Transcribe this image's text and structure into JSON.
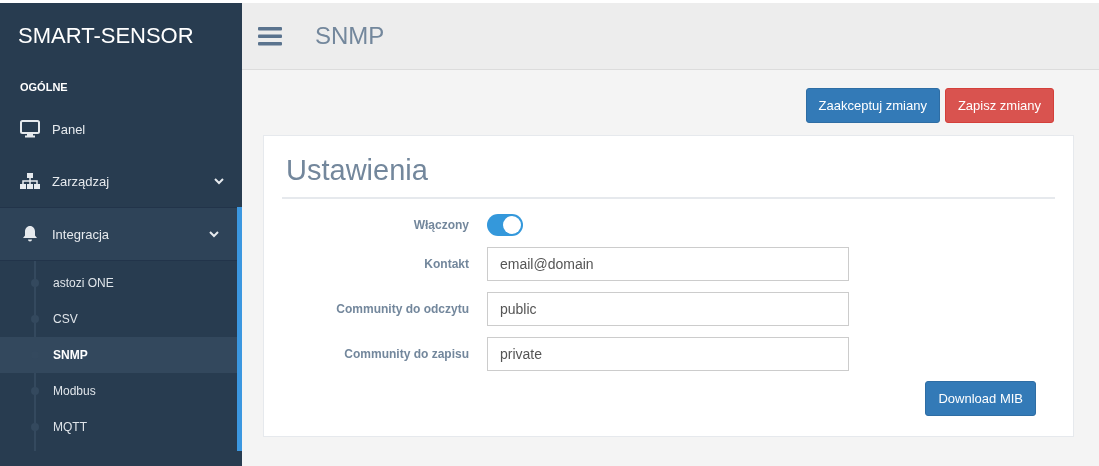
{
  "sidebar": {
    "brand": "SMART-SENSOR",
    "section_label": "OGÓLNE",
    "items": [
      {
        "kind": "link",
        "label": "Panel"
      },
      {
        "kind": "group",
        "label": "Zarządzaj",
        "expanded": false
      },
      {
        "kind": "group",
        "label": "Integracja",
        "expanded": true,
        "children": [
          {
            "label": "astozi ONE",
            "selected": false
          },
          {
            "label": "CSV",
            "selected": false
          },
          {
            "label": "SNMP",
            "selected": true
          },
          {
            "label": "Modbus",
            "selected": false
          },
          {
            "label": "MQTT",
            "selected": false
          }
        ]
      }
    ]
  },
  "header": {
    "title": "SNMP"
  },
  "actions": [
    {
      "kind": "primary",
      "label": "Zaakceptuj zmiany"
    },
    {
      "kind": "danger",
      "label": "Zapisz zmiany"
    }
  ],
  "card": {
    "title": "Ustawienia",
    "fields": [
      {
        "kind": "toggle",
        "label": "Włączony",
        "on": true
      },
      {
        "kind": "text",
        "label": "Kontakt",
        "value": "email@domain"
      },
      {
        "kind": "text",
        "label": "Community do odczytu",
        "value": "public"
      },
      {
        "kind": "text",
        "label": "Community do zapisu",
        "value": "private"
      }
    ],
    "button": "Download MIB"
  }
}
